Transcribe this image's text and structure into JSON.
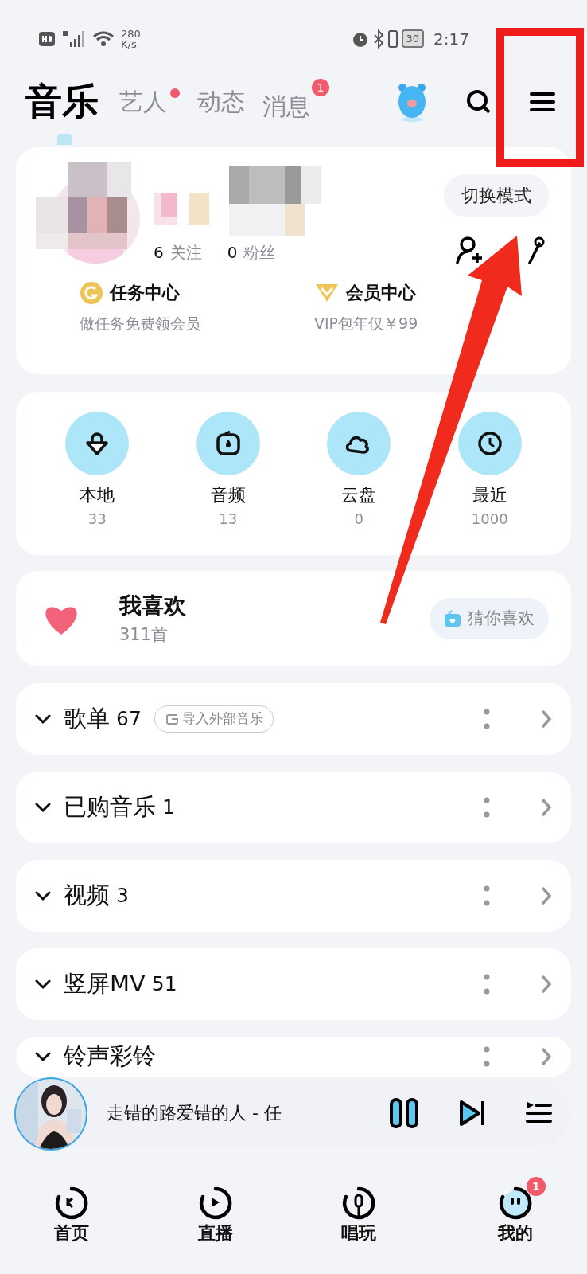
{
  "status_bar": {
    "speed": "280",
    "speed_unit": "K/s",
    "battery": "30",
    "time": "2:17"
  },
  "header": {
    "tabs": [
      {
        "label": "音乐",
        "selected": true,
        "dot": false
      },
      {
        "label": "艺人",
        "selected": false,
        "dot": true
      },
      {
        "label": "动态",
        "selected": false,
        "dot": false
      },
      {
        "label": "消息",
        "selected": false,
        "dot": false,
        "badge": "1"
      }
    ]
  },
  "profile": {
    "follow_count": "6",
    "follow_label": "关注",
    "fans_count": "0",
    "fans_label": "粉丝",
    "mode_button": "切换模式",
    "perks": [
      {
        "kind": "coin",
        "title": "任务中心",
        "subtitle": "做任务免费领会员"
      },
      {
        "kind": "vip",
        "title": "会员中心",
        "subtitle": "VIP包年仅￥99"
      }
    ]
  },
  "shortcuts": [
    {
      "kind": "local",
      "label": "本地",
      "count": "33"
    },
    {
      "kind": "audio",
      "label": "音频",
      "count": "13"
    },
    {
      "kind": "cloud",
      "label": "云盘",
      "count": "0"
    },
    {
      "kind": "recent",
      "label": "最近",
      "count": "1000"
    }
  ],
  "favorites": {
    "title": "我喜欢",
    "count": "311首",
    "button": "猜你喜欢"
  },
  "sections": [
    {
      "title": "歌单",
      "count": "67",
      "tag": "导入外部音乐"
    },
    {
      "title": "已购音乐",
      "count": "1"
    },
    {
      "title": "视频",
      "count": "3"
    },
    {
      "title": "竖屏MV",
      "count": "51"
    },
    {
      "title": "铃声彩铃"
    }
  ],
  "player": {
    "track": "走错的路爱错的人 - 任",
    "playing": true
  },
  "bottom_nav": [
    {
      "kind": "home",
      "label": "首页",
      "selected": false
    },
    {
      "kind": "live",
      "label": "直播",
      "selected": false
    },
    {
      "kind": "sing",
      "label": "唱玩",
      "selected": false
    },
    {
      "kind": "me",
      "label": "我的",
      "selected": true,
      "badge": "1"
    }
  ]
}
